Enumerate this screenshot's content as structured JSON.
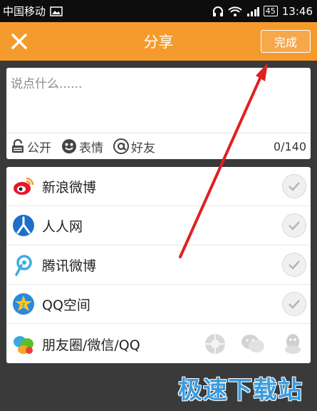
{
  "status_bar": {
    "carrier": "中国移动",
    "battery": "45",
    "time": "13:46"
  },
  "header": {
    "title": "分享",
    "done_label": "完成"
  },
  "compose": {
    "placeholder": "说点什么......",
    "public_label": "公开",
    "emoji_label": "表情",
    "friends_label": "好友",
    "counter": "0/140"
  },
  "platforms": [
    {
      "name": "新浪微博",
      "icon": "weibo-icon"
    },
    {
      "name": "人人网",
      "icon": "renren-icon"
    },
    {
      "name": "腾讯微博",
      "icon": "tencent-weibo-icon"
    },
    {
      "name": "QQ空间",
      "icon": "qzone-icon"
    },
    {
      "name": "朋友圈/微信/QQ",
      "icon": "wechat-qq-icon"
    }
  ],
  "watermark": "极速下载站",
  "colors": {
    "accent": "#f59a2d",
    "arrow": "#e02020",
    "watermark": "#3a9be0"
  }
}
